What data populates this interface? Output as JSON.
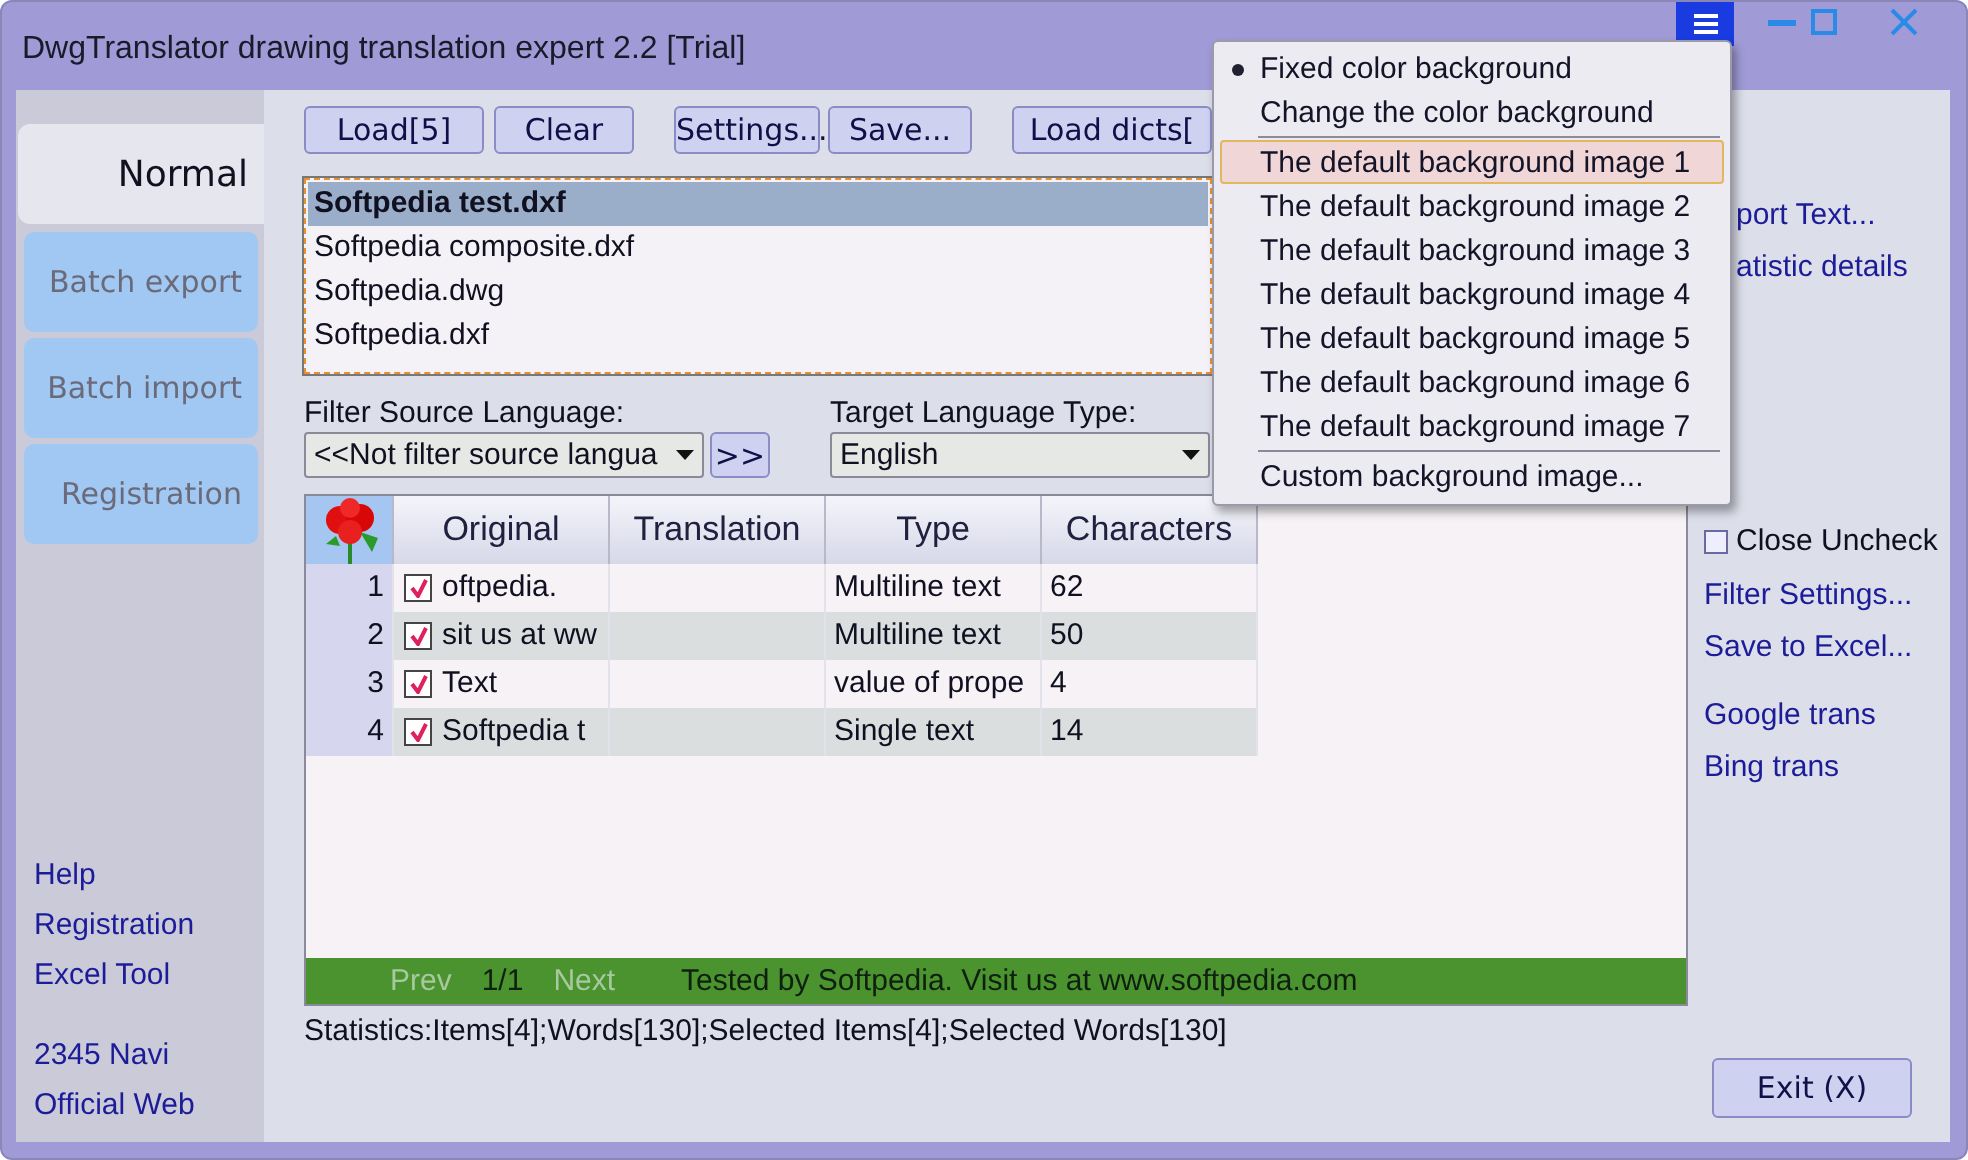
{
  "window": {
    "title": "DwgTranslator drawing translation expert 2.2 [Trial]"
  },
  "sidebar": {
    "tabs": [
      {
        "label": "Normal",
        "selected": true
      },
      {
        "label": "Batch export",
        "selected": false
      },
      {
        "label": "Batch import",
        "selected": false
      },
      {
        "label": "Registration",
        "selected": false
      }
    ],
    "links": [
      "Help",
      "Registration",
      "Excel Tool"
    ],
    "links_2": [
      "2345 Navi",
      "Official Web"
    ]
  },
  "toolbar": [
    "Load[5]",
    "Clear",
    "Settings...",
    "Save...",
    "Load dicts["
  ],
  "files": [
    {
      "name": "Softpedia test.dxf",
      "selected": true
    },
    {
      "name": "Softpedia composite.dxf",
      "selected": false
    },
    {
      "name": "Softpedia.dwg",
      "selected": false
    },
    {
      "name": "Softpedia.dxf",
      "selected": false
    }
  ],
  "filter": {
    "label": "Filter Source Language:",
    "value": "<<Not filter source langua",
    "button": ">>"
  },
  "target": {
    "label": "Target Language Type:",
    "value": "English"
  },
  "table": {
    "columns": [
      "Original",
      "Translation",
      "Type",
      "Characters"
    ],
    "rows": [
      {
        "number": "1",
        "checked": true,
        "original": "oftpedia.",
        "translation": "",
        "type": "Multiline text",
        "characters": "62"
      },
      {
        "number": "2",
        "checked": true,
        "original": "sit us at ww",
        "translation": "",
        "type": "Multiline text",
        "characters": "50"
      },
      {
        "number": "3",
        "checked": true,
        "original": "Text",
        "translation": "",
        "type": "value of prope",
        "characters": "4"
      },
      {
        "number": "4",
        "checked": true,
        "original": "Softpedia t",
        "translation": "",
        "type": "Single text",
        "characters": "14"
      }
    ]
  },
  "pager": {
    "prev": "Prev",
    "page": "1/1",
    "next": "Next",
    "note": "Tested by Softpedia. Visit us at www.softpedia.com"
  },
  "statistics": "Statistics:Items[4];Words[130];Selected Items[4];Selected Words[130]",
  "right_panel": {
    "links": [
      "port Text...",
      "atistic details"
    ],
    "close_uncheck": {
      "label": "Close Uncheck",
      "checked": false
    },
    "links_2": [
      "Filter Settings...",
      "Save to Excel..."
    ],
    "links_3": [
      "Google trans",
      "Bing trans"
    ]
  },
  "exit_button": "Exit (X)",
  "menu": [
    {
      "kind": "option",
      "label": "Fixed color background",
      "checked": true,
      "selected": false
    },
    {
      "kind": "option",
      "label": "Change the color background",
      "checked": false,
      "selected": false
    },
    {
      "kind": "separator"
    },
    {
      "kind": "option",
      "label": "The default background image 1",
      "checked": false,
      "selected": true
    },
    {
      "kind": "option",
      "label": "The default background image 2",
      "checked": false,
      "selected": false
    },
    {
      "kind": "option",
      "label": "The default background image 3",
      "checked": false,
      "selected": false
    },
    {
      "kind": "option",
      "label": "The default background image 4",
      "checked": false,
      "selected": false
    },
    {
      "kind": "option",
      "label": "The default background image 5",
      "checked": false,
      "selected": false
    },
    {
      "kind": "option",
      "label": "The default background image 6",
      "checked": false,
      "selected": false
    },
    {
      "kind": "option",
      "label": "The default background image 7",
      "checked": false,
      "selected": false
    },
    {
      "kind": "separator"
    },
    {
      "kind": "option",
      "label": "Custom background image...",
      "checked": false,
      "selected": false
    }
  ]
}
